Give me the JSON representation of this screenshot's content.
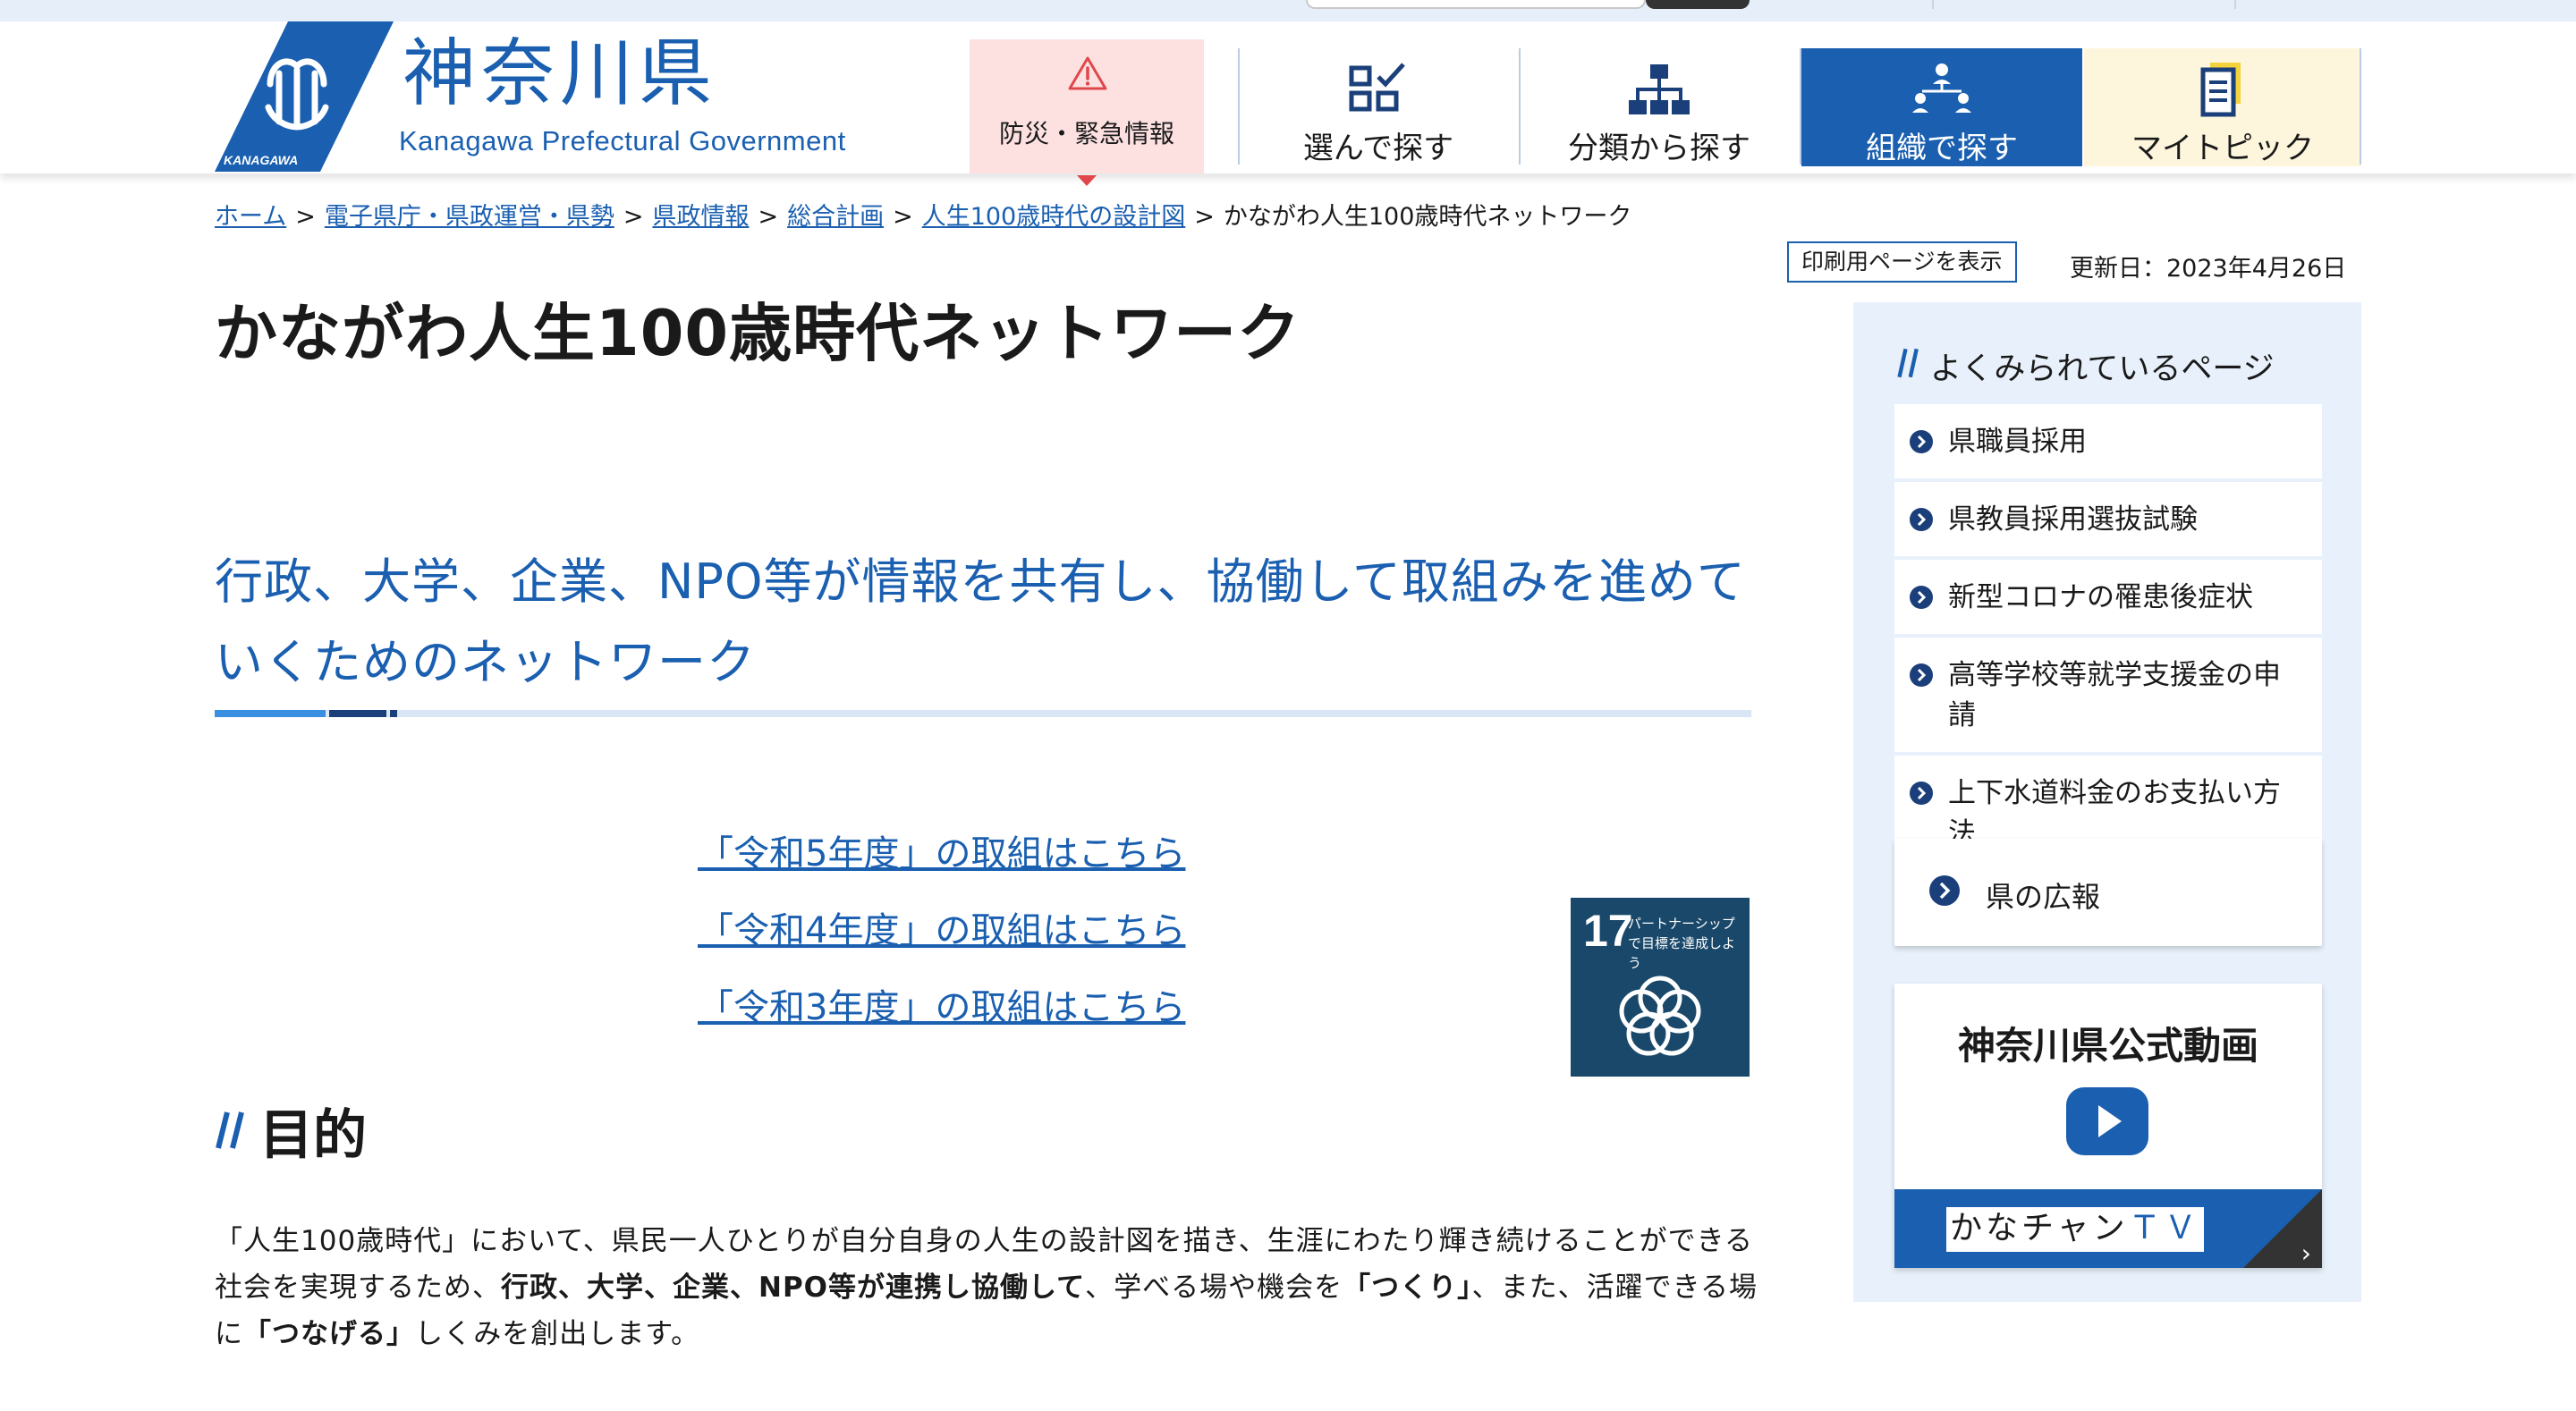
{
  "header": {
    "site_title": "神奈川県",
    "site_subtitle": "Kanagawa Prefectural Government",
    "logo_caption": "KANAGAWA",
    "disaster_label": "防災・緊急情報",
    "nav": [
      {
        "label": "選んで探す",
        "icon": "checklist-icon"
      },
      {
        "label": "分類から探す",
        "icon": "hierarchy-icon"
      },
      {
        "label": "組織で探す",
        "icon": "organization-icon"
      },
      {
        "label": "マイトピック",
        "icon": "document-icon"
      }
    ]
  },
  "breadcrumb": {
    "items": [
      "ホーム",
      "電子県庁・県政運営・県勢",
      "県政情報",
      "総合計画",
      "人生100歳時代の設計図"
    ],
    "current": "かながわ人生100歳時代ネットワーク",
    "separator": ">"
  },
  "print_button": "印刷用ページを表示",
  "updated": "更新日：2023年4月26日",
  "page_title": "かながわ人生100歳時代ネットワーク",
  "lead": "行政、大学、企業、NPO等が情報を共有し、協働して取組みを進めていくためのネットワーク",
  "links": [
    "「令和5年度」の取組はこちら",
    "「令和4年度」の取組はこちら",
    "「令和3年度」の取組はこちら"
  ],
  "sdg": {
    "number": "17",
    "text": "パートナーシップで目標を達成しよう",
    "color": "#19486a"
  },
  "section": {
    "heading": "目的",
    "body_1": "「人生100歳時代」において、県民一人ひとりが自分自身の人生の設計図を描き、生涯にわたり輝き続けることができる社会を実現するため、",
    "body_bold_1": "行政、大学、企業、NPO等が連携し協働して",
    "body_2": "、学べる場や機会を",
    "body_bold_2": "「つくり」",
    "body_3": "、また、活躍できる場に",
    "body_bold_3": "「つなげる」",
    "body_4": "しくみを創出します。"
  },
  "sidebar": {
    "popular_heading": "よくみられているページ",
    "popular": [
      "県職員採用",
      "県教員採用選抜試験",
      "新型コロナの罹患後症状",
      "高等学校等就学支援金の申請",
      "上下水道料金のお支払い方法"
    ],
    "koho": "県の広報",
    "video_title": "神奈川県公式動画",
    "video_brand_kana": "かなチャン",
    "video_brand_tv": "ＴＶ"
  },
  "colors": {
    "brand_blue": "#1a5fb0",
    "disaster_bg": "#fde1e1",
    "topic_bg": "#fdf6dd",
    "sidebar_bg": "#e8f1fb"
  }
}
